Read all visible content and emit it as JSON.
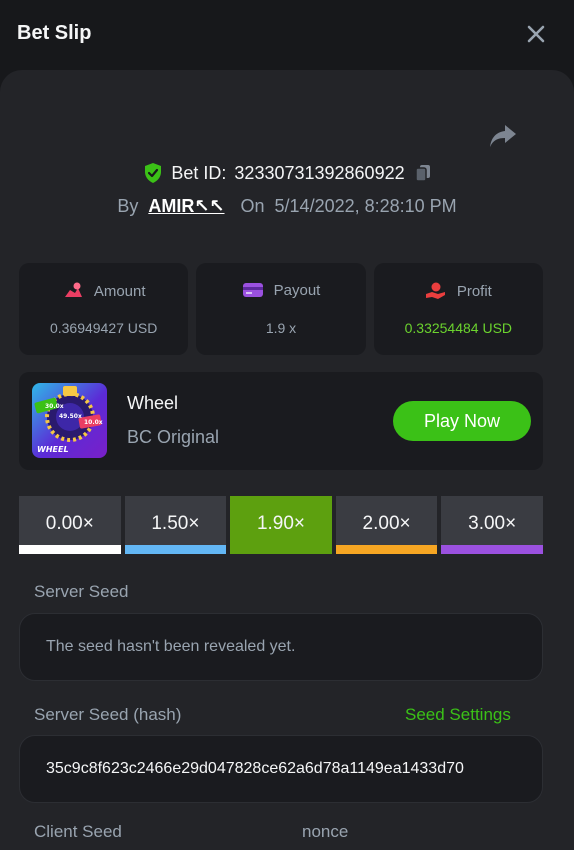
{
  "header": {
    "title": "Bet Slip"
  },
  "bet": {
    "id_label": "Bet ID:",
    "id": "32330731392860922",
    "by_label": "By",
    "user": "AMIR↖↖",
    "on_label": "On",
    "date": "5/14/2022, 8:28:10 PM"
  },
  "stats": [
    {
      "label": "Amount",
      "value": "0.36949427 USD",
      "icon": "amount-icon"
    },
    {
      "label": "Payout",
      "value": "1.9 x",
      "icon": "payout-icon"
    },
    {
      "label": "Profit",
      "value": "0.33254484 USD",
      "icon": "profit-icon"
    }
  ],
  "game": {
    "name": "Wheel",
    "subtitle": "BC Original",
    "play_label": "Play Now",
    "thumb_text": "WHEEL",
    "thumb_values": [
      "30.0x",
      "49.50x",
      "10.0x"
    ]
  },
  "multipliers": [
    {
      "label": "0.00×",
      "color": "#ffffff",
      "selected": false
    },
    {
      "label": "1.50×",
      "color": "#63b7f5",
      "selected": false
    },
    {
      "label": "1.90×",
      "color": "#5da00f",
      "selected": true
    },
    {
      "label": "2.00×",
      "color": "#f6a623",
      "selected": false
    },
    {
      "label": "3.00×",
      "color": "#9b51e0",
      "selected": false
    }
  ],
  "seeds": {
    "server_label": "Server Seed",
    "server_value": "The seed hasn't been revealed yet.",
    "hash_label": "Server Seed (hash)",
    "settings_label": "Seed Settings",
    "hash_value": "35c9c8f623c2466e29d047828ce62a6d78a1149ea1433d70",
    "client_label": "Client Seed",
    "nonce_label": "nonce"
  },
  "colors": {
    "accent": "#3bc117",
    "profit": "#6bd32e",
    "bg": "#17181b",
    "panel": "#232428",
    "card": "#1a1b1f"
  }
}
